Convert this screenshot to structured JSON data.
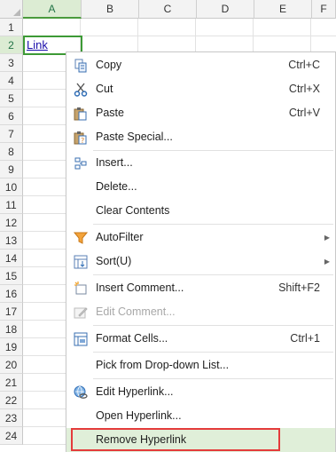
{
  "sheet": {
    "columns": [
      "A",
      "B",
      "C",
      "D",
      "E",
      "F"
    ],
    "rows": [
      "1",
      "2",
      "3",
      "4",
      "5",
      "6",
      "7",
      "8",
      "9",
      "10",
      "11",
      "12",
      "13",
      "14",
      "15",
      "16",
      "17",
      "18",
      "19",
      "20",
      "21",
      "22",
      "23",
      "24"
    ],
    "active_cell_text": "Link"
  },
  "menu": {
    "items": [
      {
        "label": "Copy",
        "shortcut": "Ctrl+C",
        "icon": "copy-icon"
      },
      {
        "label": "Cut",
        "shortcut": "Ctrl+X",
        "icon": "cut-icon"
      },
      {
        "label": "Paste",
        "shortcut": "Ctrl+V",
        "icon": "paste-icon"
      },
      {
        "label": "Paste Special...",
        "shortcut": "",
        "icon": "paste-special-icon"
      },
      {
        "label": "Insert...",
        "shortcut": "",
        "icon": "insert-icon"
      },
      {
        "label": "Delete...",
        "shortcut": "",
        "icon": ""
      },
      {
        "label": "Clear Contents",
        "shortcut": "",
        "icon": ""
      },
      {
        "label": "AutoFilter",
        "shortcut": "",
        "icon": "filter-icon"
      },
      {
        "label": "Sort(U)",
        "shortcut": "",
        "icon": "sort-icon"
      },
      {
        "label": "Insert Comment...",
        "shortcut": "Shift+F2",
        "icon": "insert-comment-icon"
      },
      {
        "label": "Edit Comment...",
        "shortcut": "",
        "icon": "edit-comment-icon"
      },
      {
        "label": "Format Cells...",
        "shortcut": "Ctrl+1",
        "icon": "format-cells-icon"
      },
      {
        "label": "Pick from Drop-down List...",
        "shortcut": "",
        "icon": ""
      },
      {
        "label": "Edit Hyperlink...",
        "shortcut": "",
        "icon": "hyperlink-icon"
      },
      {
        "label": "Open Hyperlink...",
        "shortcut": "",
        "icon": ""
      },
      {
        "label": "Remove Hyperlink",
        "shortcut": "",
        "icon": ""
      }
    ]
  },
  "colors": {
    "selection_green": "#3d9a36",
    "hover_green": "#e0efd9",
    "highlight_red": "#e43b3b",
    "link_blue": "#1a0dab"
  }
}
